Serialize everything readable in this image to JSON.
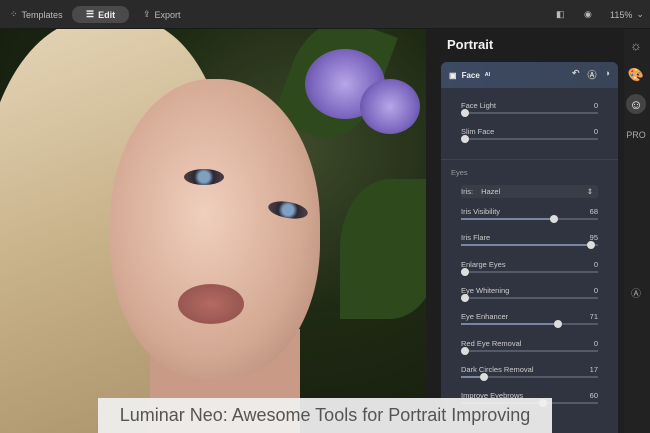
{
  "toolbar": {
    "templates": "Templates",
    "edit": "Edit",
    "export": "Export",
    "zoom": "115%"
  },
  "panel": {
    "title": "Portrait",
    "card_title": "Face",
    "card_badge": "ᴬᴵ",
    "face_sliders": [
      {
        "label": "Face Light",
        "value": 0
      },
      {
        "label": "Slim Face",
        "value": 0
      }
    ],
    "eyes_section": "Eyes",
    "iris": {
      "label": "Iris:",
      "value": "Hazel"
    },
    "eye_sliders": [
      {
        "label": "Iris Visibility",
        "value": 68
      },
      {
        "label": "Iris Flare",
        "value": 95
      },
      {
        "label": "Enlarge Eyes",
        "value": 0
      },
      {
        "label": "Eye Whitening",
        "value": 0
      },
      {
        "label": "Eye Enhancer",
        "value": 71
      },
      {
        "label": "Red Eye Removal",
        "value": 0
      },
      {
        "label": "Dark Circles Removal",
        "value": 17
      },
      {
        "label": "Improve Eyebrows",
        "value": 60
      }
    ]
  },
  "sidebar": {
    "pro": "PRO"
  },
  "caption": "Luminar Neo: Awesome Tools for Portrait Improving"
}
